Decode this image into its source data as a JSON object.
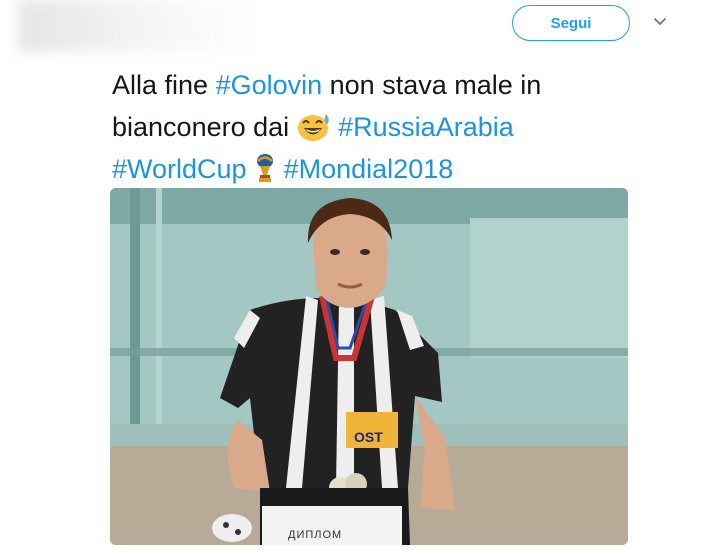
{
  "header": {
    "follow_label": "Segui",
    "menu_icon": "chevron-down-icon"
  },
  "tweet": {
    "line1_prefix": "Alla fine ",
    "hashtag1": "#Golovin",
    "line1_suffix": " non stava male in",
    "line2_prefix": "bianconero dai ",
    "emoji1": "grinning-sweat-emoji",
    "hashtag2": "#RussiaArabia",
    "hashtag3": "#WorldCup",
    "emoji2": "world-cup-trophy-icon",
    "hashtag4": "#Mondial2018"
  },
  "photo": {
    "sign_text": "ДИПЛОМ",
    "shirt_sponsor_text": "OST"
  },
  "colors": {
    "link": "#1b95e0",
    "text": "#14171a",
    "button_border": "#1da1f2"
  }
}
